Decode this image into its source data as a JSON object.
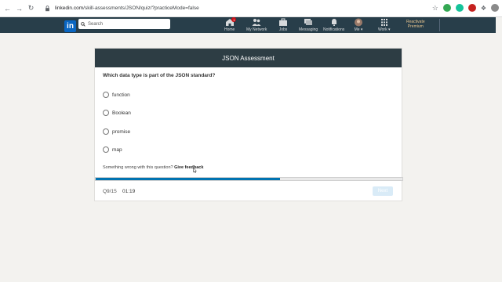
{
  "browser": {
    "url_host": "linkedin.com",
    "url_path": "/skill-assessments/JSON/quiz/?practiceMode=false"
  },
  "navbar": {
    "search_placeholder": "Search",
    "items": [
      {
        "label": "Home",
        "icon": "home-icon",
        "badge": "1"
      },
      {
        "label": "My Network",
        "icon": "network-icon"
      },
      {
        "label": "Jobs",
        "icon": "jobs-icon"
      },
      {
        "label": "Messaging",
        "icon": "messaging-icon"
      },
      {
        "label": "Notifications",
        "icon": "bell-icon"
      },
      {
        "label": "Me ▾",
        "icon": "avatar"
      },
      {
        "label": "Work ▾",
        "icon": "grid-icon"
      }
    ],
    "premium_line1": "Reactivate",
    "premium_line2": "Premium"
  },
  "assessment": {
    "title": "JSON Assessment",
    "question": "Which data type is part of the JSON standard?",
    "options": [
      "function",
      "Boolean",
      "promise",
      "map"
    ],
    "feedback_text": "Something wrong with this question?",
    "feedback_link": "Give feedback",
    "progress_fraction": 0.6,
    "counter": "Q9/15",
    "timer": "01:19",
    "next_label": "Next"
  },
  "colors": {
    "nav_bg": "#283e4a",
    "header_bg": "#2d3d44",
    "progress": "#0073b1",
    "next_disabled": "#d9ebf7"
  }
}
